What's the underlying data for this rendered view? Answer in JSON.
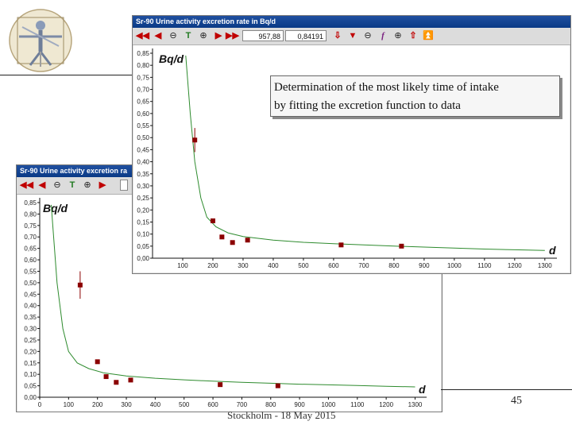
{
  "footer": {
    "text": "Stockholm - 18 May 2015",
    "page_number": "45"
  },
  "annotation": {
    "line1": "Determination of the most likely time of intake",
    "line2": "by fitting the excretion function to data"
  },
  "back_window": {
    "title": "Sr-90  Urine activity excretion ra",
    "toolbar": {
      "icons": [
        "rewind-icon",
        "back-icon",
        "zoom-out-icon",
        "text-icon",
        "zoom-in-icon",
        "forward-icon"
      ]
    }
  },
  "front_window": {
    "title": "Sr-90  Urine activity excretion rate in Bq/d",
    "toolbar": {
      "x_value": "957,88",
      "y_value": "0,84191",
      "icons": [
        "rewind-icon",
        "back-icon",
        "zoom-out-icon",
        "text-icon",
        "zoom-in-icon",
        "forward-icon",
        "fast-forward-icon",
        "down-arrow-icon",
        "down-bar-icon",
        "zoom-out-icon",
        "function-icon",
        "zoom-in-icon",
        "up-arrow-icon",
        "up-double-icon"
      ]
    }
  },
  "chart_data": [
    {
      "type": "scatter",
      "title": "",
      "ylabel": "Bq/d",
      "xlabel": "d",
      "xlim": [
        0,
        1340
      ],
      "ylim": [
        0,
        0.85
      ],
      "x_ticks": [
        "0",
        "100",
        "200",
        "300",
        "400",
        "500",
        "600",
        "700",
        "800",
        "900",
        "1000",
        "1100",
        "1200",
        "1300"
      ],
      "y_ticks": [
        "0,00",
        "0,05",
        "0,10",
        "0,15",
        "0,20",
        "0,25",
        "0,30",
        "0,35",
        "0,40",
        "0,45",
        "0,50",
        "0,55",
        "0,60",
        "0,65",
        "0,70",
        "0,75",
        "0,80",
        "0,85"
      ],
      "grid": false,
      "colors": {
        "points": "#8b0000",
        "curve": "#2e8b2e"
      },
      "points": [
        {
          "x": 140,
          "y": 0.49,
          "err": 0.06
        },
        {
          "x": 200,
          "y": 0.155
        },
        {
          "x": 230,
          "y": 0.09
        },
        {
          "x": 265,
          "y": 0.065
        },
        {
          "x": 315,
          "y": 0.075
        },
        {
          "x": 625,
          "y": 0.055
        },
        {
          "x": 825,
          "y": 0.05
        }
      ],
      "fit_curve": [
        [
          40,
          0.84
        ],
        [
          60,
          0.5
        ],
        [
          80,
          0.3
        ],
        [
          100,
          0.2
        ],
        [
          130,
          0.15
        ],
        [
          170,
          0.125
        ],
        [
          220,
          0.107
        ],
        [
          300,
          0.093
        ],
        [
          400,
          0.083
        ],
        [
          500,
          0.076
        ],
        [
          600,
          0.07
        ],
        [
          700,
          0.065
        ],
        [
          800,
          0.061
        ],
        [
          900,
          0.057
        ],
        [
          1000,
          0.054
        ],
        [
          1100,
          0.051
        ],
        [
          1200,
          0.048
        ],
        [
          1300,
          0.045
        ]
      ]
    },
    {
      "type": "scatter",
      "title": "",
      "ylabel": "Bq/d",
      "xlabel": "d",
      "xlim": [
        0,
        1340
      ],
      "ylim": [
        0,
        0.85
      ],
      "x_ticks": [
        "100",
        "200",
        "300",
        "400",
        "500",
        "600",
        "700",
        "800",
        "900",
        "1000",
        "1100",
        "1200",
        "1300"
      ],
      "y_ticks": [
        "0,00",
        "0,05",
        "0,10",
        "0,15",
        "0,20",
        "0,25",
        "0,30",
        "0,35",
        "0,40",
        "0,45",
        "0,50",
        "0,55",
        "0,60",
        "0,65",
        "0,70",
        "0,75",
        "0,80",
        "0,85"
      ],
      "grid": false,
      "colors": {
        "points": "#8b0000",
        "curve": "#2e8b2e"
      },
      "points": [
        {
          "x": 140,
          "y": 0.49,
          "err": 0.05
        },
        {
          "x": 200,
          "y": 0.155
        },
        {
          "x": 230,
          "y": 0.088
        },
        {
          "x": 265,
          "y": 0.065
        },
        {
          "x": 315,
          "y": 0.075
        },
        {
          "x": 625,
          "y": 0.055
        },
        {
          "x": 825,
          "y": 0.05
        }
      ],
      "fit_curve": [
        [
          110,
          0.84
        ],
        [
          125,
          0.6
        ],
        [
          140,
          0.4
        ],
        [
          160,
          0.25
        ],
        [
          180,
          0.17
        ],
        [
          210,
          0.13
        ],
        [
          250,
          0.105
        ],
        [
          300,
          0.09
        ],
        [
          400,
          0.075
        ],
        [
          500,
          0.066
        ],
        [
          600,
          0.06
        ],
        [
          700,
          0.055
        ],
        [
          800,
          0.05
        ],
        [
          900,
          0.046
        ],
        [
          1000,
          0.042
        ],
        [
          1100,
          0.038
        ],
        [
          1200,
          0.035
        ],
        [
          1300,
          0.032
        ]
      ]
    }
  ]
}
